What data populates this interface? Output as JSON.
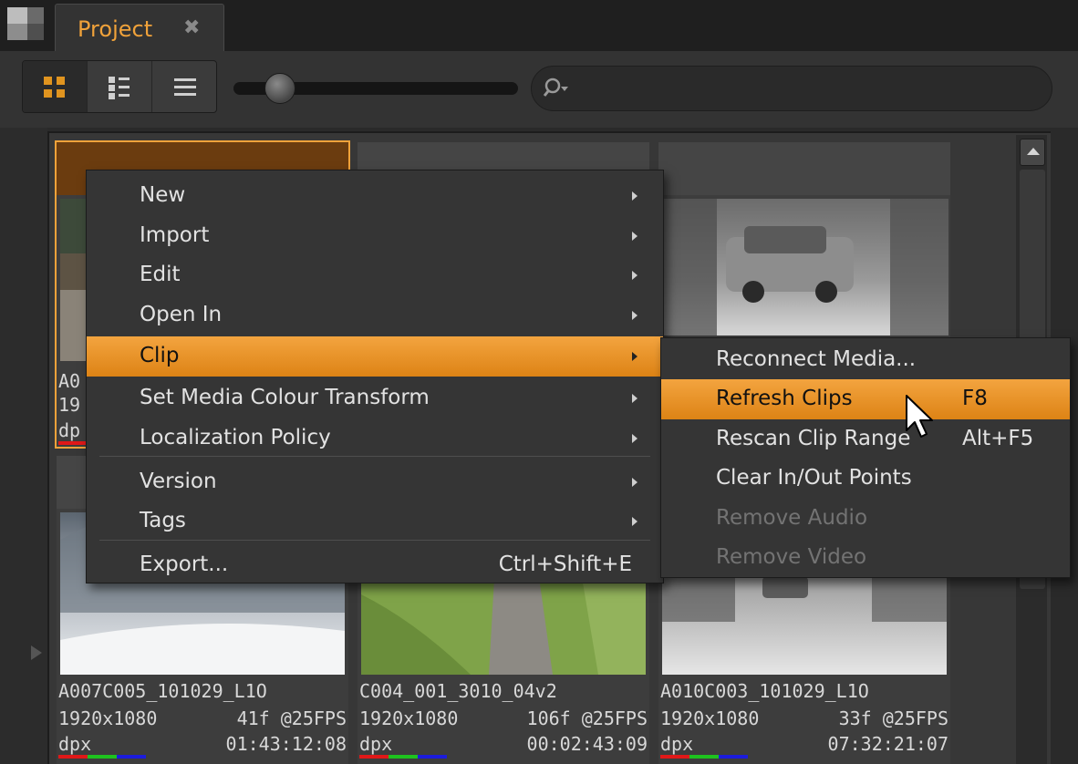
{
  "tab": {
    "title": "Project",
    "close": "✖"
  },
  "toolbar": {
    "views": [
      {
        "icon": "thumbnail-grid-icon",
        "active": true
      },
      {
        "icon": "detail-list-icon",
        "active": false
      },
      {
        "icon": "list-icon",
        "active": false
      }
    ],
    "search": {
      "placeholder": ""
    }
  },
  "clips": [
    {
      "name": "A0",
      "res": "19",
      "format": "dp",
      "selected": true
    },
    {
      "name": "",
      "res": "",
      "format": ""
    },
    {
      "name": "",
      "res": "",
      "format": ""
    },
    {
      "name": "A007C005_101029_L1O",
      "res": "1920x1080",
      "frames": "41f @25FPS",
      "format": "dpx",
      "timecode": "01:43:12:08"
    },
    {
      "name": "C004_001_3010_04v2",
      "res": "1920x1080",
      "frames": "106f @25FPS",
      "format": "dpx",
      "timecode": "00:02:43:09"
    },
    {
      "name": "A010C003_101029_L1O",
      "res": "1920x1080",
      "frames": "33f @25FPS",
      "format": "dpx",
      "timecode": "07:32:21:07"
    }
  ],
  "context_menu": {
    "items": [
      {
        "label": "New",
        "submenu": true
      },
      {
        "label": "Import",
        "submenu": true
      },
      {
        "label": "Edit",
        "submenu": true
      },
      {
        "label": "Open In",
        "submenu": true
      },
      {
        "label": "Clip",
        "submenu": true,
        "highlighted": true
      },
      {
        "label": "Set Media Colour Transform",
        "submenu": true
      },
      {
        "label": "Localization Policy",
        "submenu": true
      },
      {
        "label": "Version",
        "submenu": true
      },
      {
        "label": "Tags",
        "submenu": true
      },
      {
        "label": "Export...",
        "shortcut": "Ctrl+Shift+E"
      }
    ]
  },
  "clip_submenu": {
    "items": [
      {
        "label": "Reconnect Media..."
      },
      {
        "label": "Refresh Clips",
        "shortcut": "F8",
        "highlighted": true
      },
      {
        "label": "Rescan Clip Range",
        "shortcut": "Alt+F5"
      },
      {
        "label": "Clear In/Out Points"
      },
      {
        "label": "Remove Audio",
        "disabled": true
      },
      {
        "label": "Remove Video",
        "disabled": true
      }
    ]
  },
  "colors": {
    "accent": "#f0a23a",
    "highlight": "#e8901f"
  }
}
